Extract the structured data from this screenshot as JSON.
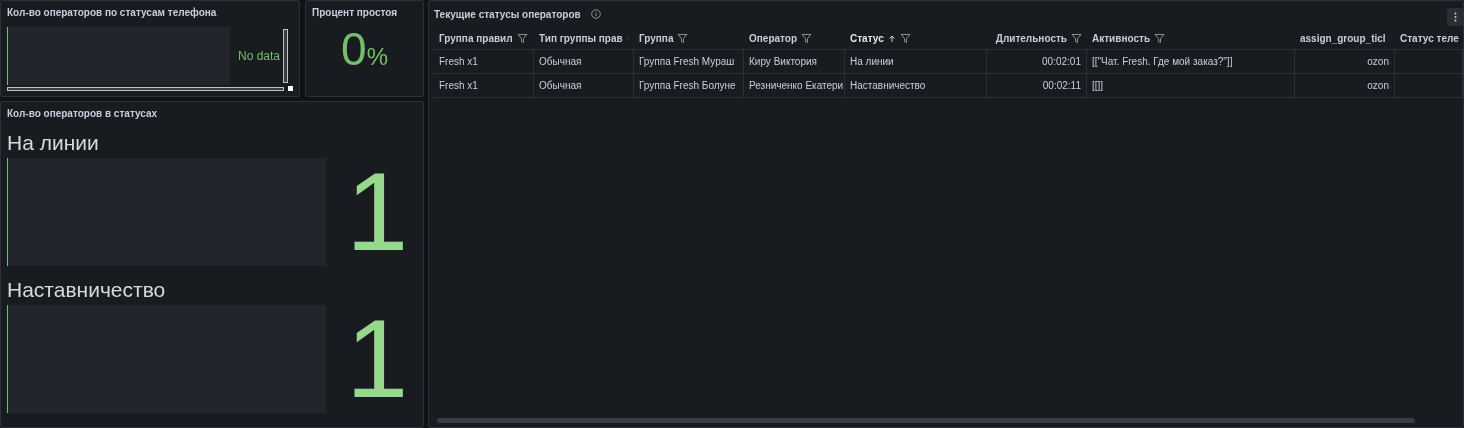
{
  "phone_panel": {
    "title": "Кол-во операторов по статусам телефона",
    "message": "No data"
  },
  "idle_panel": {
    "title": "Процент простоя",
    "value": "0",
    "unit": "%"
  },
  "status_panel": {
    "title": "Кол-во операторов в статусах",
    "items": [
      {
        "label": "На линии",
        "value": "1"
      },
      {
        "label": "Наставничество",
        "value": "1"
      }
    ]
  },
  "table_panel": {
    "title": "Текущие статусы операторов",
    "columns": [
      {
        "label": "Группа правил",
        "sorted": false
      },
      {
        "label": "Тип группы прав",
        "sorted": false
      },
      {
        "label": "Группа",
        "sorted": false
      },
      {
        "label": "Оператор",
        "sorted": false
      },
      {
        "label": "Статус",
        "sorted": true
      },
      {
        "label": "Длительность",
        "sorted": false
      },
      {
        "label": "Активность",
        "sorted": false
      },
      {
        "label": "assign_group_ticl",
        "sorted": false
      },
      {
        "label": "Статус теле",
        "sorted": false
      }
    ],
    "rows": [
      [
        "Fresh x1",
        "Обычная",
        "Группа Fresh Мураш",
        "Киру Виктория",
        "На линии",
        "00:02:01",
        "[[\"Чат. Fresh. Где мой заказ?\"]]",
        "ozon",
        ""
      ],
      [
        "Fresh x1",
        "Обычная",
        "Группа Fresh Болуне",
        "Резниченко Екатери",
        "Наставничество",
        "00:02:11",
        "[[]]",
        "ozon",
        ""
      ]
    ]
  }
}
